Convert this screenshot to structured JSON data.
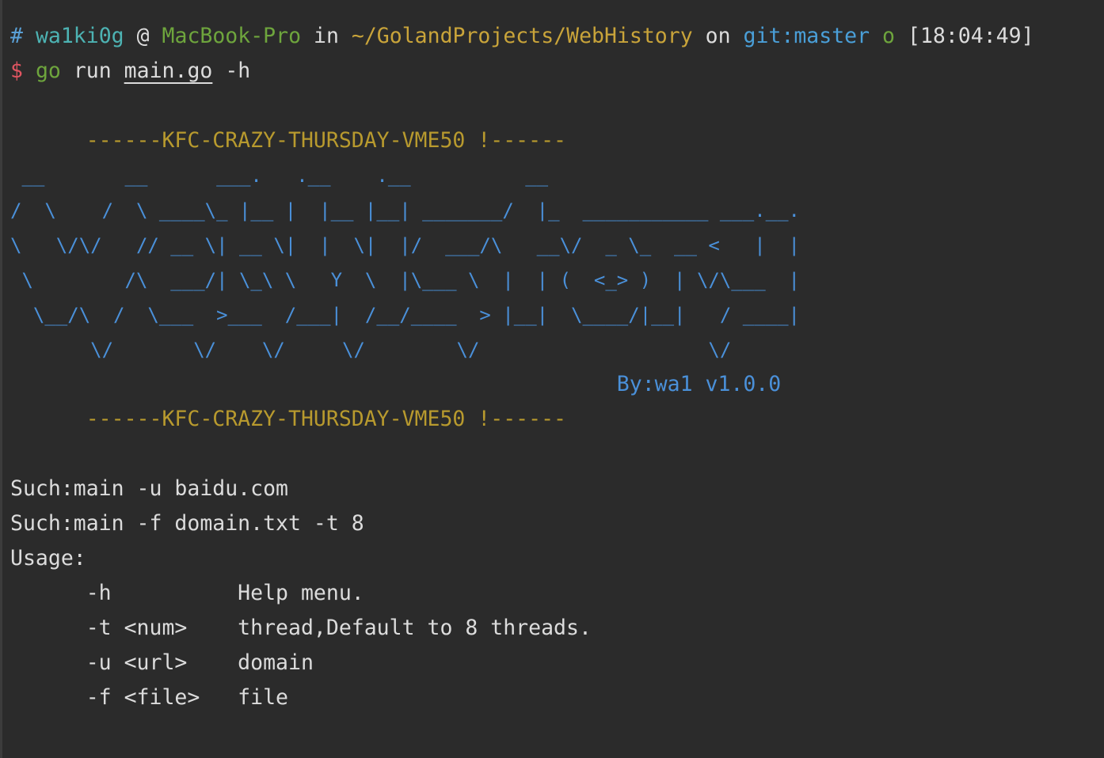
{
  "prompt": {
    "hash": "#",
    "user": "wa1ki0g",
    "at": "@",
    "host": "MacBook-Pro",
    "in": "in",
    "path": "~/GolandProjects/WebHistory",
    "on": "on",
    "git": "git:master",
    "status": "o",
    "time": "[18:04:49]"
  },
  "command": {
    "dollar": "$",
    "go": "go",
    "run": "run",
    "file": "main.go",
    "flag": "-h"
  },
  "banner_top": "      ------KFC-CRAZY-THURSDAY-VME50 !------",
  "ascii_art": [
    " __       __      ___.   .__    .__          __",
    "/  \\    /  \\ ____\\_ |__ |  |__ |__| _______/  |_  ___________ ___.__.",
    "\\   \\/\\/   // __ \\| __ \\|  |  \\|  |/  ___/\\   __\\/  _ \\_  __ <   |  |",
    " \\        /\\  ___/| \\_\\ \\   Y  \\  |\\___ \\  |  | (  <_> )  | \\/\\___  |",
    "  \\__/\\  /  \\___  >___  /___|  /__/____  > |__|  \\____/|__|   / ____|",
    "       \\/       \\/    \\/     \\/        \\/                    \\/"
  ],
  "byline": "                                                By:wa1 v1.0.0",
  "banner_bottom": "      ------KFC-CRAZY-THURSDAY-VME50 !------",
  "usage": {
    "example1": "Such:main -u baidu.com",
    "example2": "Such:main -f domain.txt -t 8",
    "title": "Usage:",
    "options": [
      "      -h          Help menu.",
      "      -t <num>    thread,Default to 8 threads.",
      "      -u <url>    domain",
      "      -f <file>   file"
    ]
  }
}
